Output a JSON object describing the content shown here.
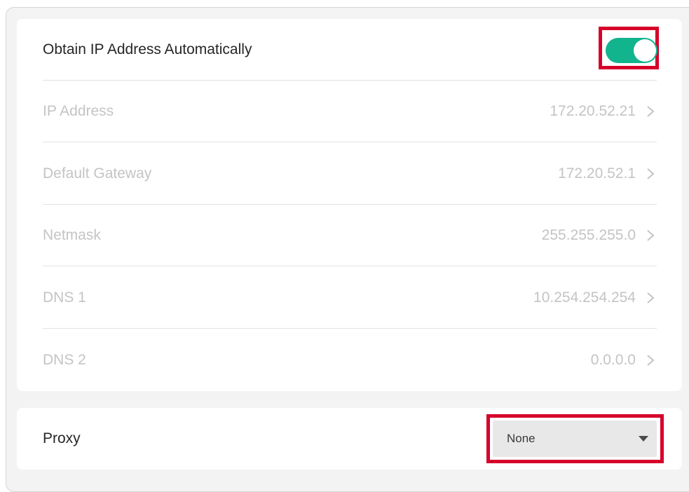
{
  "ip_settings": {
    "auto_ip": {
      "label": "Obtain IP Address Automatically",
      "enabled": true,
      "toggle_color": "#12b48e"
    },
    "rows": [
      {
        "label": "IP Address",
        "value": "172.20.52.21"
      },
      {
        "label": "Default Gateway",
        "value": "172.20.52.1"
      },
      {
        "label": "Netmask",
        "value": "255.255.255.0"
      },
      {
        "label": "DNS 1",
        "value": "10.254.254.254"
      },
      {
        "label": "DNS 2",
        "value": "0.0.0.0"
      }
    ]
  },
  "proxy": {
    "label": "Proxy",
    "selected": "None"
  },
  "highlight_color": "#d6002a",
  "icons": {
    "row_arrow": "chevron-right-icon",
    "dropdown_arrow": "caret-down-icon"
  }
}
